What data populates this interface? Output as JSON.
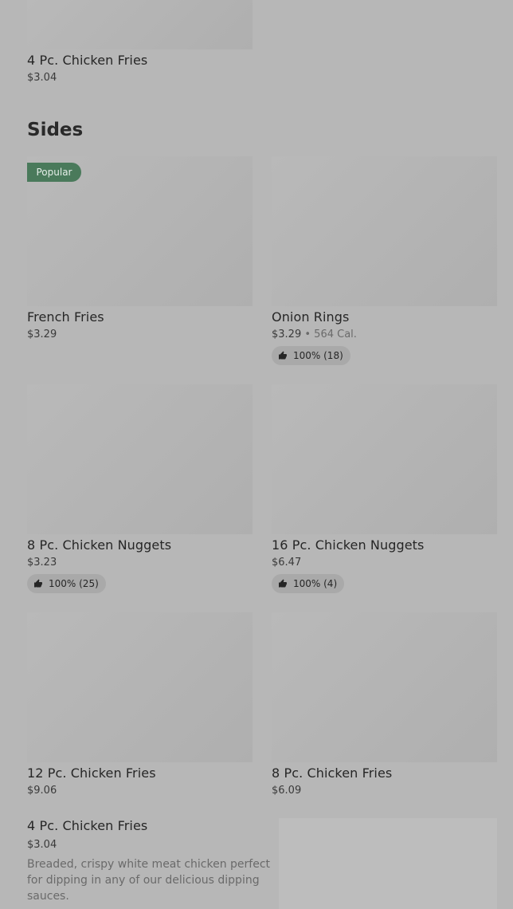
{
  "top_item": {
    "title": "4 Pc. Chicken Fries",
    "price": "$3.04"
  },
  "section": {
    "heading": "Sides"
  },
  "items": [
    {
      "title": "French Fries",
      "price": "$3.29",
      "badge": "Popular"
    },
    {
      "title": "Onion Rings",
      "price": "$3.29",
      "calories": "564 Cal.",
      "rating": "100% (18)"
    },
    {
      "title": "8 Pc. Chicken Nuggets",
      "price": "$3.23",
      "rating": "100% (25)"
    },
    {
      "title": "16 Pc. Chicken Nuggets",
      "price": "$6.47",
      "rating": "100% (4)"
    },
    {
      "title": "12 Pc. Chicken Fries",
      "price": "$9.06"
    },
    {
      "title": "8 Pc. Chicken Fries",
      "price": "$6.09"
    }
  ],
  "bottom_sheet": {
    "title": "4 Pc. Chicken Fries",
    "price": "$3.04",
    "description": "Breaded, crispy white meat chicken perfect for dipping in any of our delicious dipping sauces."
  },
  "separator": "•",
  "colors": {
    "badge": "#4a7a5b",
    "overlay": "#b7b7b7"
  }
}
